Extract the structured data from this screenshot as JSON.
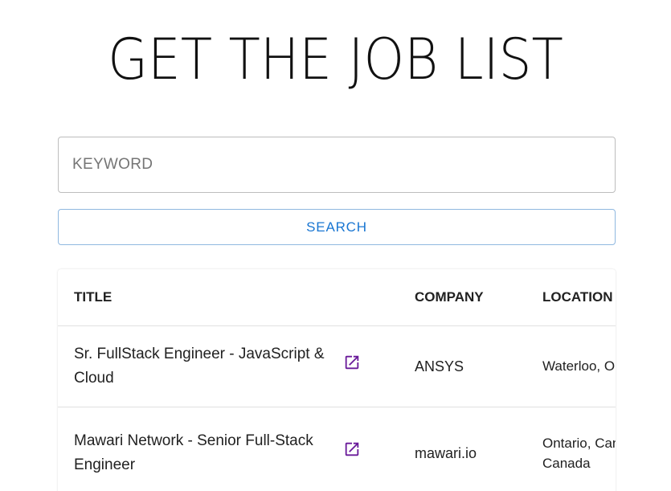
{
  "page": {
    "title": "GET THE JOB LIST"
  },
  "search": {
    "placeholder": "KEYWORD",
    "value": "",
    "button_label": "SEARCH"
  },
  "table": {
    "headers": {
      "title": "TITLE",
      "company": "COMPANY",
      "location": "LOCATION"
    },
    "rows": [
      {
        "title": "Sr. FullStack Engineer - JavaScript & Cloud",
        "company": "ANSYS",
        "location": "Waterloo, O",
        "link_icon": "open-in-new-icon"
      },
      {
        "title": "Mawari Network - Senior Full-Stack Engineer",
        "company": "mawari.io",
        "location": "Ontario, CanadaWat Canada",
        "link_icon": "open-in-new-icon"
      }
    ]
  },
  "colors": {
    "accent": "#1976d2",
    "link_icon": "#6a1b9a"
  }
}
